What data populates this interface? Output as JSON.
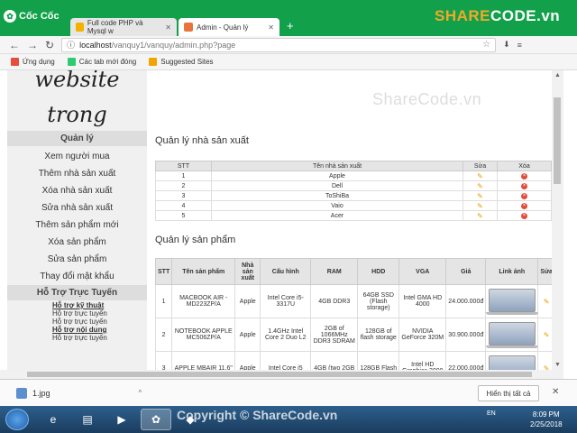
{
  "browser": {
    "brand": "Cốc Cốc",
    "tabs": [
      {
        "title": "Full code PHP và Mysql w",
        "fav_color": "#f3b100"
      },
      {
        "title": "Admin - Quản lý",
        "fav_color": "#e8743b"
      }
    ],
    "address": {
      "host": "localhost",
      "path": "/vanquy1/vanquy/admin.php?page"
    },
    "bookmarks": [
      {
        "label": "Ứng dụng",
        "color": "#e74c3c"
      },
      {
        "label": "Các tab mới đóng",
        "color": "#2ecc71"
      },
      {
        "label": "Suggested Sites",
        "color": "#f0a500"
      }
    ]
  },
  "watermark": {
    "logo_prefix": "SHARE",
    "logo_suffix": "CODE.vn",
    "center": "ShareCode.vn",
    "copyright": "Copyright © ShareCode.vn"
  },
  "sidebar": {
    "script_line1": "website",
    "script_line2": "trong",
    "header_manage": "Quản lý",
    "links": [
      "Xem người mua",
      "Thêm nhà sản xuất",
      "Xóa nhà sản xuất",
      "Sửa nhà sản xuất",
      "Thêm sản phẩm mới",
      "Xóa sản phẩm",
      "Sửa sản phẩm",
      "Thay đổi mật khẩu"
    ],
    "header_support": "Hỗ Trợ Trực Tuyến",
    "support_items": [
      {
        "text": "Hỗ trợ kỹ thuật",
        "bold": true
      },
      {
        "text": "Hỗ trợ trực tuyến",
        "bold": false
      },
      {
        "text": "Hỗ trợ trực tuyến",
        "bold": false
      },
      {
        "text": "Hỗ trợ nội dung",
        "bold": true
      },
      {
        "text": "Hỗ trợ trực tuyến",
        "bold": false
      }
    ]
  },
  "makers": {
    "title": "Quản lý nhà sản xuất",
    "headers": [
      "STT",
      "Tên nhà sản xuất",
      "Sửa",
      "Xóa"
    ],
    "rows": [
      {
        "stt": "1",
        "name": "Apple"
      },
      {
        "stt": "2",
        "name": "Dell"
      },
      {
        "stt": "3",
        "name": "ToShiBa"
      },
      {
        "stt": "4",
        "name": "Vaio"
      },
      {
        "stt": "5",
        "name": "Acer"
      }
    ]
  },
  "products": {
    "title": "Quản lý sản phẩm",
    "headers": [
      "STT",
      "Tên sản phẩm",
      "Nhà sản xuất",
      "Cấu hình",
      "RAM",
      "HDD",
      "VGA",
      "Giá",
      "Link ảnh",
      "Sửa"
    ],
    "rows": [
      {
        "stt": "1",
        "name": "MACBOOK AIR - MD223ZP/A",
        "maker": "Apple",
        "cpu": "Intel Core i5-3317U",
        "ram": "4GB DDR3",
        "hdd": "64GB SSD (Flash storage)",
        "vga": "Intel GMA HD 4000",
        "price": "24.000.000đ"
      },
      {
        "stt": "2",
        "name": "NOTEBOOK APPLE MC506ZP/A",
        "maker": "Apple",
        "cpu": "1.4GHz Intel Core 2 Duo L2",
        "ram": "2GB of 1066MHz DDR3 SDRAM",
        "hdd": "128GB of flash storage",
        "vga": "NVIDIA GeForce 320M",
        "price": "30.900.000đ"
      },
      {
        "stt": "3",
        "name": "APPLE MBAIR 11.6\"",
        "maker": "Apple",
        "cpu": "Intel Core i5",
        "ram": "4GB (two 2GB",
        "hdd": "128GB Flash",
        "vga": "Intel HD Graphics 3000",
        "price": "22.000.000đ"
      }
    ]
  },
  "download": {
    "file": "1.jpg",
    "show_all": "Hiển thị tất cả"
  },
  "taskbar": {
    "time": "8:09 PM",
    "date": "2/25/2018",
    "lang": "EN"
  }
}
